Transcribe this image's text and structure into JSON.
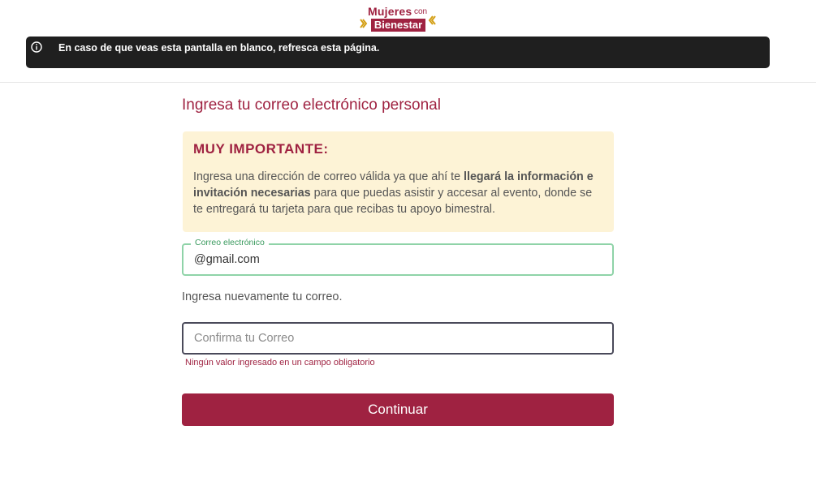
{
  "logo": {
    "line1": "Mujeres",
    "line1_small": "con",
    "line2": "Bienestar"
  },
  "banner": {
    "icon": "info-icon",
    "text": "En caso de que veas esta pantalla en blanco, refresca esta página."
  },
  "page_title": "Ingresa tu correo electrónico personal",
  "notice": {
    "title": "MUY IMPORTANTE:",
    "body_part1": "Ingresa una dirección de correo válida ya que ahí te ",
    "body_bold": "llegará la información e invitación necesarias",
    "body_part2": " para que puedas asistir y accesar al evento, donde se te entregará tu tarjeta para que recibas tu apoyo bimestral."
  },
  "email_field": {
    "label": "Correo electrónico",
    "value": "@gmail.com"
  },
  "helper_text": "Ingresa nuevamente tu correo.",
  "confirm_field": {
    "placeholder": "Confirma tu Correo",
    "value": ""
  },
  "error_text": "Ningún valor ingresado en un campo obligatorio",
  "continue_label": "Continuar",
  "colors": {
    "brand": "#9f2241",
    "banner_bg": "#1f1f1f",
    "notice_bg": "#fdf3d6",
    "focus_border": "#8fd3a8",
    "logo_accent": "#d4a017"
  }
}
